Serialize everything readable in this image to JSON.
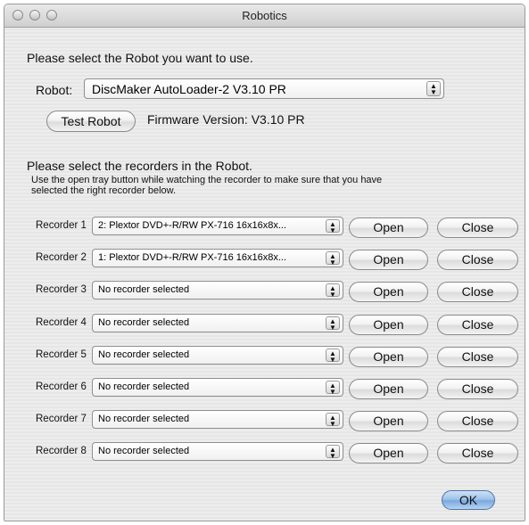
{
  "window": {
    "title": "Robotics"
  },
  "prompt_robot": "Please select the Robot you want to use.",
  "robot": {
    "label": "Robot:",
    "selected": "DiscMaker AutoLoader-2 V3.10 PR",
    "test_button": "Test Robot",
    "firmware": "Firmware Version: V3.10 PR"
  },
  "recorders_heading": "Please select the recorders in the Robot.",
  "recorders_help_line1": "Use the open tray button while watching the recorder to make sure that you have",
  "recorders_help_line2": "selected the right recorder below.",
  "open_label": "Open",
  "close_label": "Close",
  "recorders": [
    {
      "label": "Recorder 1",
      "value": "2: Plextor DVD+-R/RW PX-716 16x16x8x..."
    },
    {
      "label": "Recorder 2",
      "value": "1: Plextor DVD+-R/RW PX-716 16x16x8x..."
    },
    {
      "label": "Recorder 3",
      "value": "No recorder selected"
    },
    {
      "label": "Recorder 4",
      "value": "No recorder selected"
    },
    {
      "label": "Recorder 5",
      "value": "No recorder selected"
    },
    {
      "label": "Recorder 6",
      "value": "No recorder selected"
    },
    {
      "label": "Recorder 7",
      "value": "No recorder selected"
    },
    {
      "label": "Recorder 8",
      "value": "No recorder selected"
    }
  ],
  "ok_label": "OK"
}
